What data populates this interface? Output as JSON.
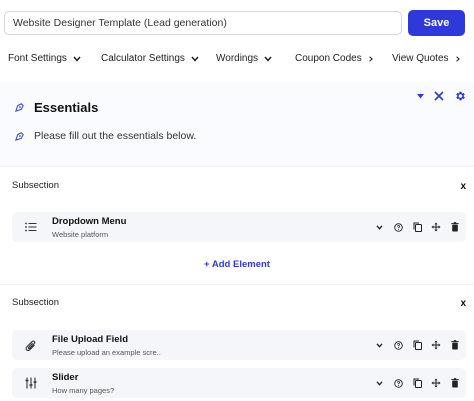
{
  "header": {
    "title_value": "Website Designer Template (Lead generation)",
    "save_label": "Save"
  },
  "tabs": [
    {
      "label": "Font Settings",
      "icon": "chevron-down-icon"
    },
    {
      "label": "Calculator Settings",
      "icon": "chevron-down-icon"
    },
    {
      "label": "Wordings",
      "icon": "chevron-down-icon"
    },
    {
      "label": "Coupon Codes",
      "icon": "chevron-right-icon"
    },
    {
      "label": "View Quotes",
      "icon": "chevron-right-icon"
    }
  ],
  "essentials": {
    "title": "Essentials",
    "description": "Please fill out the essentials below."
  },
  "subsections": [
    {
      "title": "Subsection",
      "close_label": "x",
      "elements": [
        {
          "name": "Dropdown Menu",
          "subtitle": "Website platform",
          "icon": "list-icon"
        }
      ],
      "add_label": "+ Add Element"
    },
    {
      "title": "Subsection",
      "close_label": "x",
      "elements": [
        {
          "name": "File Upload Field",
          "subtitle": "Please upload an example scre..",
          "icon": "paperclip-icon"
        },
        {
          "name": "Slider",
          "subtitle": "How many pages?",
          "icon": "sliders-icon"
        }
      ]
    }
  ],
  "colors": {
    "accent": "#2f39d9",
    "section_bg": "#fafbfe",
    "row_bg": "#f5f6f9"
  }
}
